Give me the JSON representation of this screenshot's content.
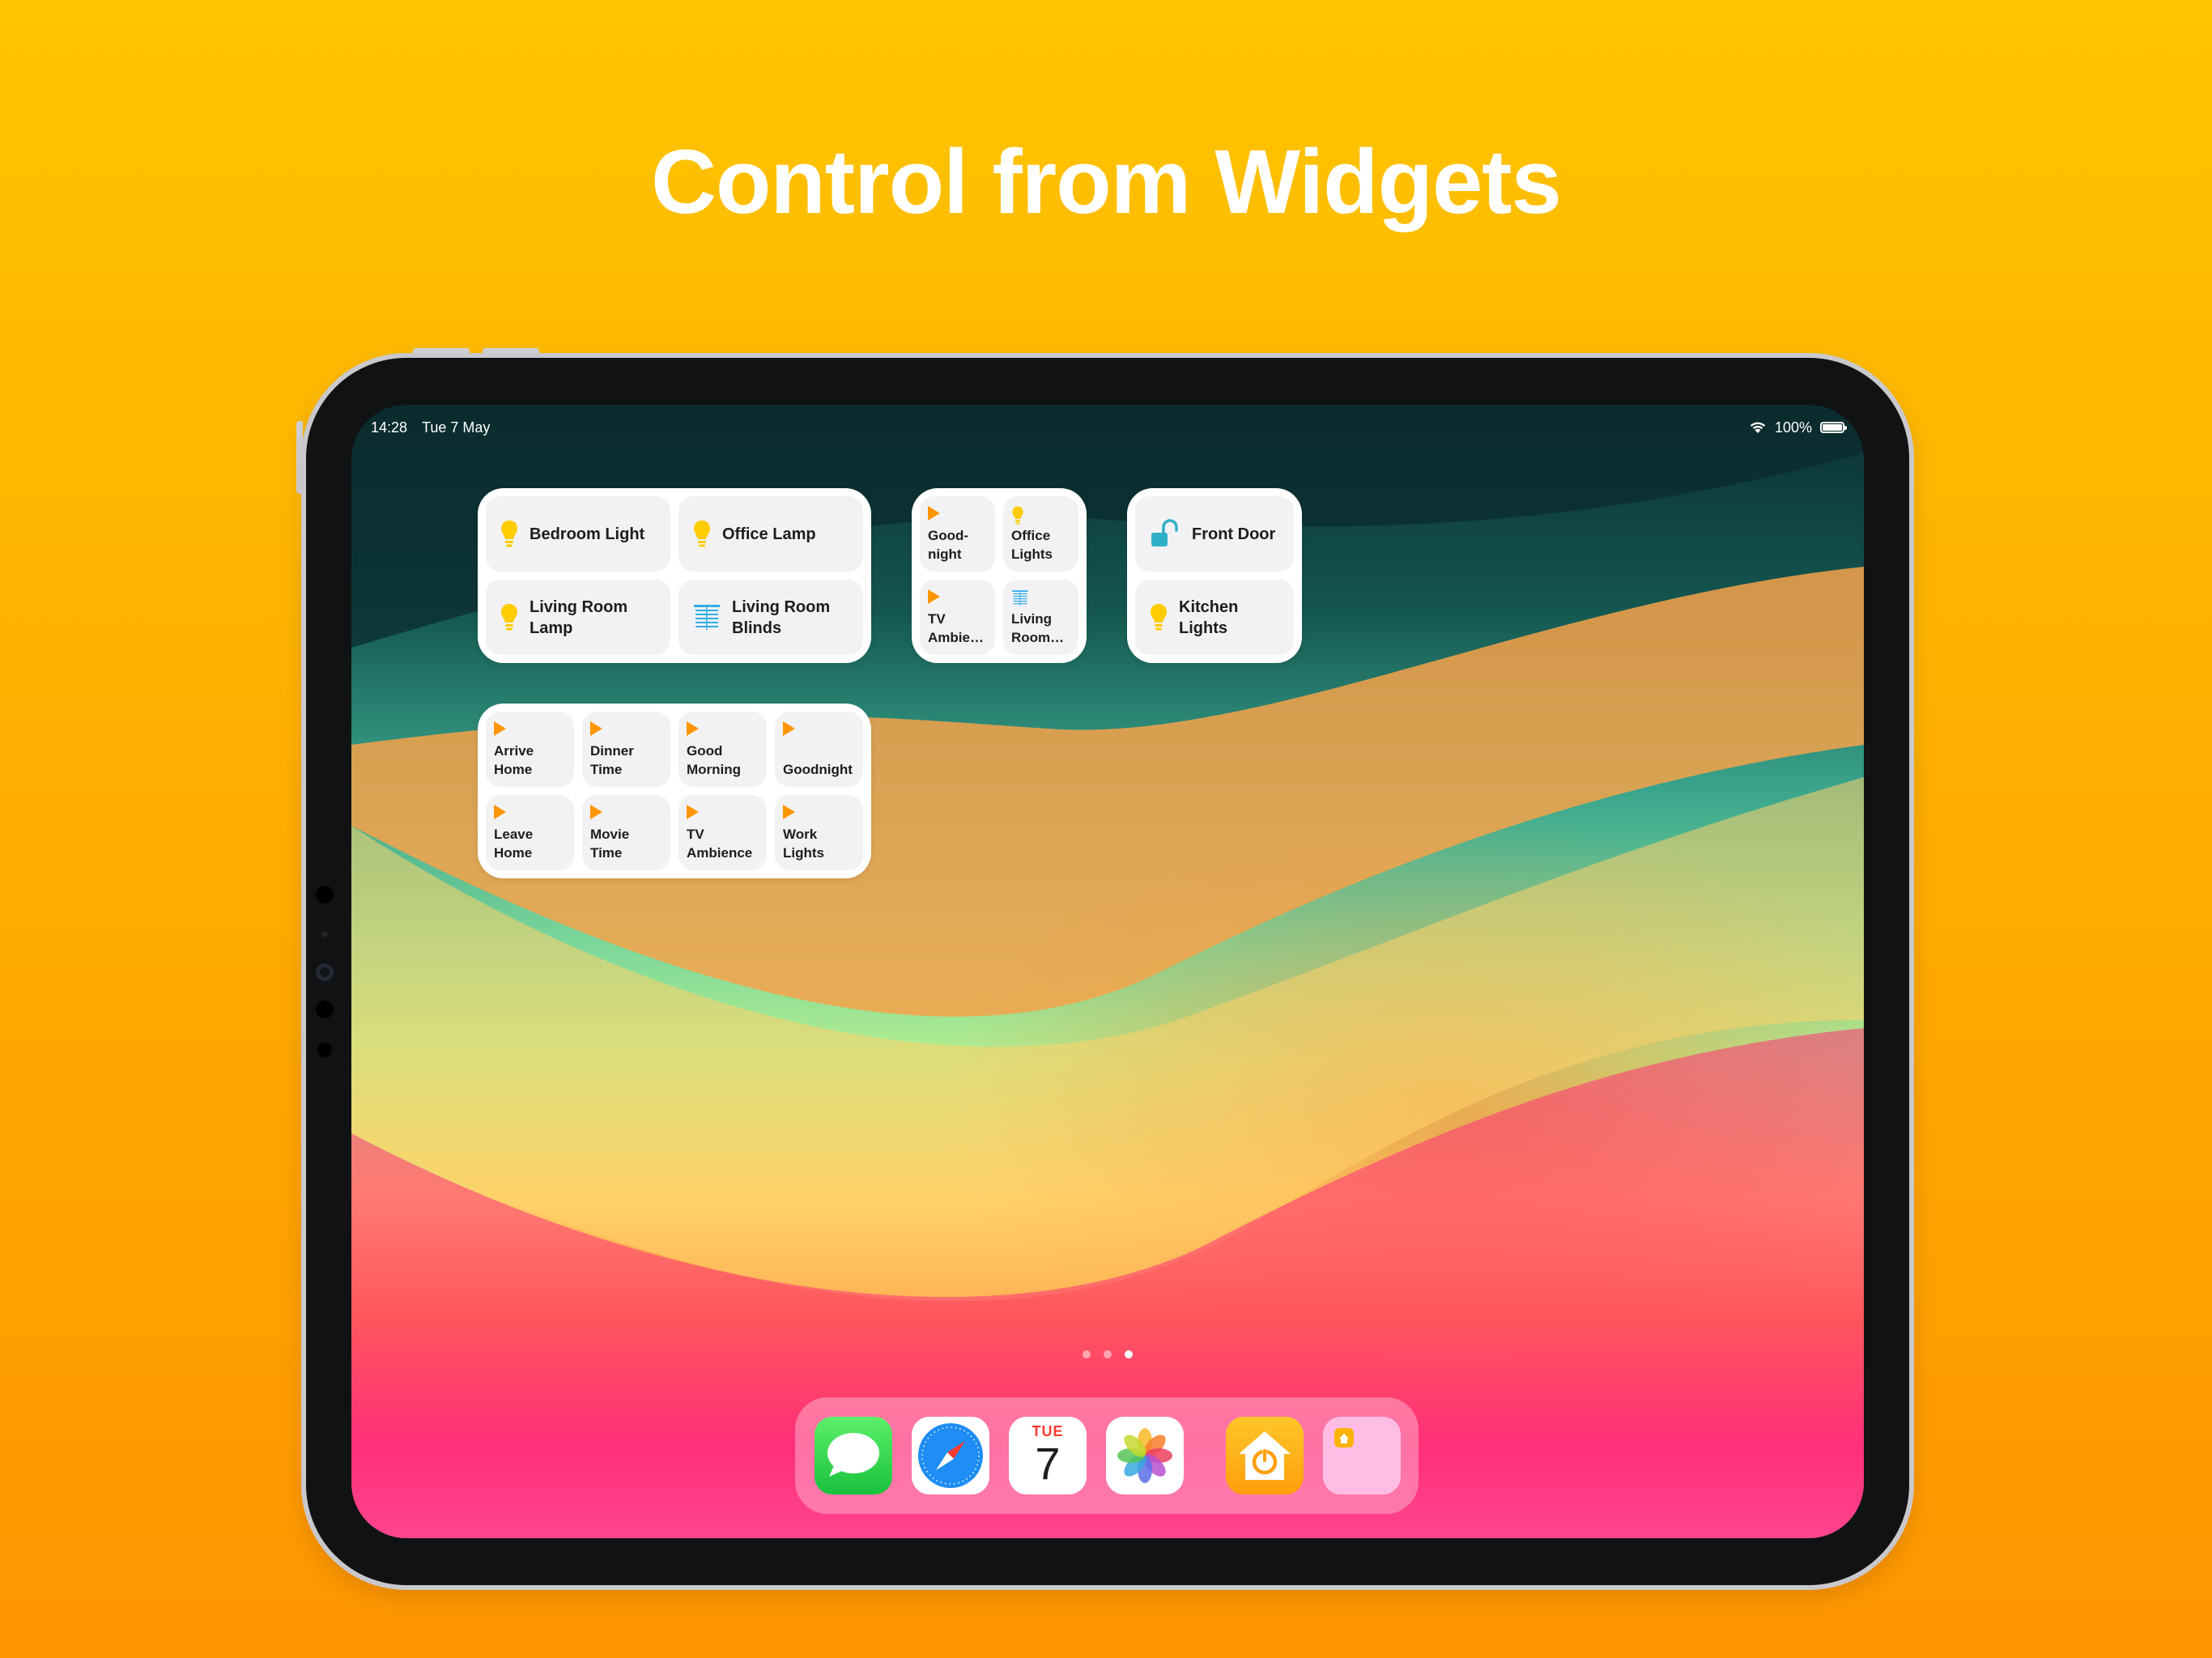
{
  "headline": "Control from Widgets",
  "status_bar": {
    "time": "14:28",
    "date": "Tue 7 May",
    "battery": "100%"
  },
  "widgets": {
    "accessories": [
      {
        "label": "Bedroom Light",
        "icon": "lightbulb-icon"
      },
      {
        "label": "Office Lamp",
        "icon": "lightbulb-icon"
      },
      {
        "label": "Living Room Lamp",
        "icon": "lightbulb-icon"
      },
      {
        "label": "Living Room Blinds",
        "icon": "blinds-icon"
      }
    ],
    "mixed_small": [
      {
        "label": "Good-\nnight",
        "icon": "play-icon"
      },
      {
        "label": "Office Lights",
        "icon": "lightbulb-icon"
      },
      {
        "label": "TV Ambie…",
        "icon": "play-icon"
      },
      {
        "label": "Living Room…",
        "icon": "blinds-icon"
      }
    ],
    "door_kitchen": [
      {
        "label": "Front Door",
        "icon": "unlocked-lock-icon"
      },
      {
        "label": "Kitchen Lights",
        "icon": "lightbulb-icon"
      }
    ],
    "scenes": [
      {
        "label": "Arrive Home"
      },
      {
        "label": "Dinner Time"
      },
      {
        "label": "Good Morning"
      },
      {
        "label": "Goodnight"
      },
      {
        "label": "Leave Home"
      },
      {
        "label": "Movie Time"
      },
      {
        "label": "TV Ambience"
      },
      {
        "label": "Work Lights"
      }
    ]
  },
  "page_indicator": {
    "pages": 3,
    "current": 3
  },
  "dock": {
    "apps": [
      "messages-icon",
      "safari-icon",
      "calendar-icon",
      "photos-icon",
      "home-power-app-icon",
      "widget-app-icon"
    ],
    "calendar_day": "TUE",
    "calendar_date": "7"
  },
  "colors": {
    "background_top": "#ffc400",
    "background_bottom": "#ff9500",
    "scene_accent": "#ff9500",
    "bulb": "#ffcc00",
    "blinds": "#32ade6",
    "lock": "#30b0c7"
  }
}
